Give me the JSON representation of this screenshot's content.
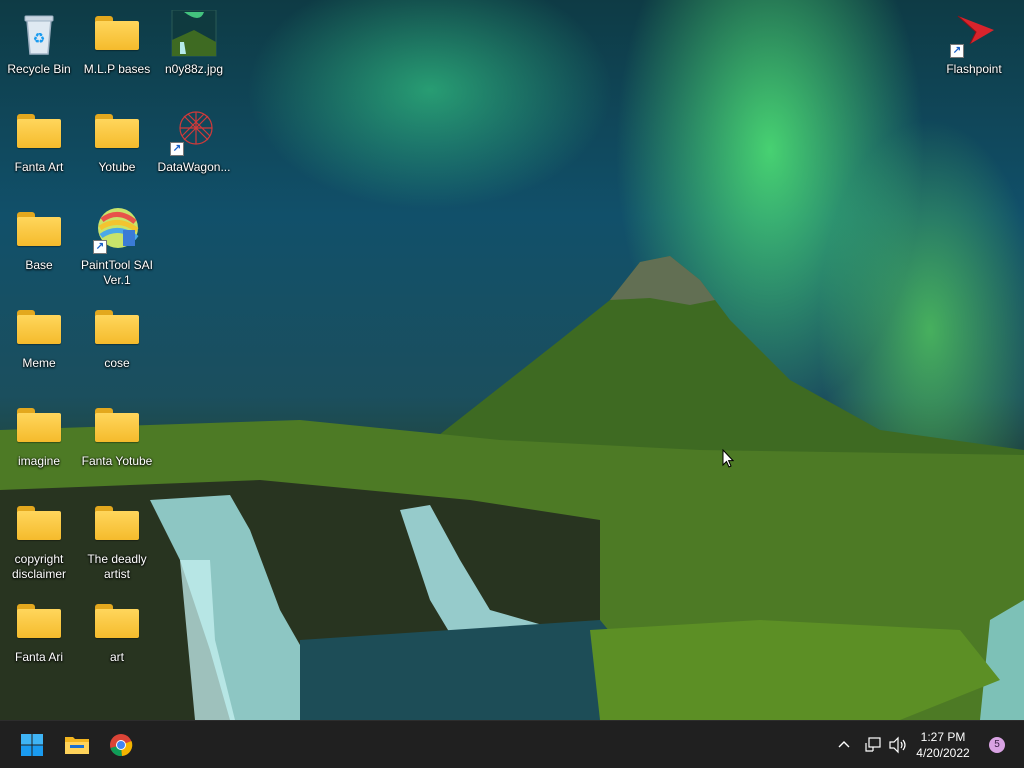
{
  "desktop": {
    "icons": [
      {
        "label": "Recycle Bin"
      },
      {
        "label": "M.L.P bases"
      },
      {
        "label": "n0y88z.jpg"
      },
      {
        "label": "Fanta Art"
      },
      {
        "label": "Yotube"
      },
      {
        "label": "DataWagon..."
      },
      {
        "label": "Base"
      },
      {
        "label": "PaintTool SAI Ver.1"
      },
      {
        "label": "Meme"
      },
      {
        "label": "cose"
      },
      {
        "label": "imagine"
      },
      {
        "label": "Fanta Yotube"
      },
      {
        "label": "copyright disclaimer"
      },
      {
        "label": "The deadly artist"
      },
      {
        "label": "Fanta Ari"
      },
      {
        "label": "art"
      },
      {
        "label": "Flashpoint"
      }
    ]
  },
  "taskbar": {
    "pinned": [
      {
        "icon": "windows-start-icon"
      },
      {
        "icon": "file-explorer-icon"
      },
      {
        "icon": "chrome-icon"
      }
    ],
    "tray": {
      "time": "1:27 PM",
      "date": "4/20/2022",
      "notifications": "5"
    }
  },
  "colors": {
    "taskbar_bg": "#202020",
    "folder_yellow": "#f5bb2c",
    "accent_blue": "#1a9bf0"
  }
}
